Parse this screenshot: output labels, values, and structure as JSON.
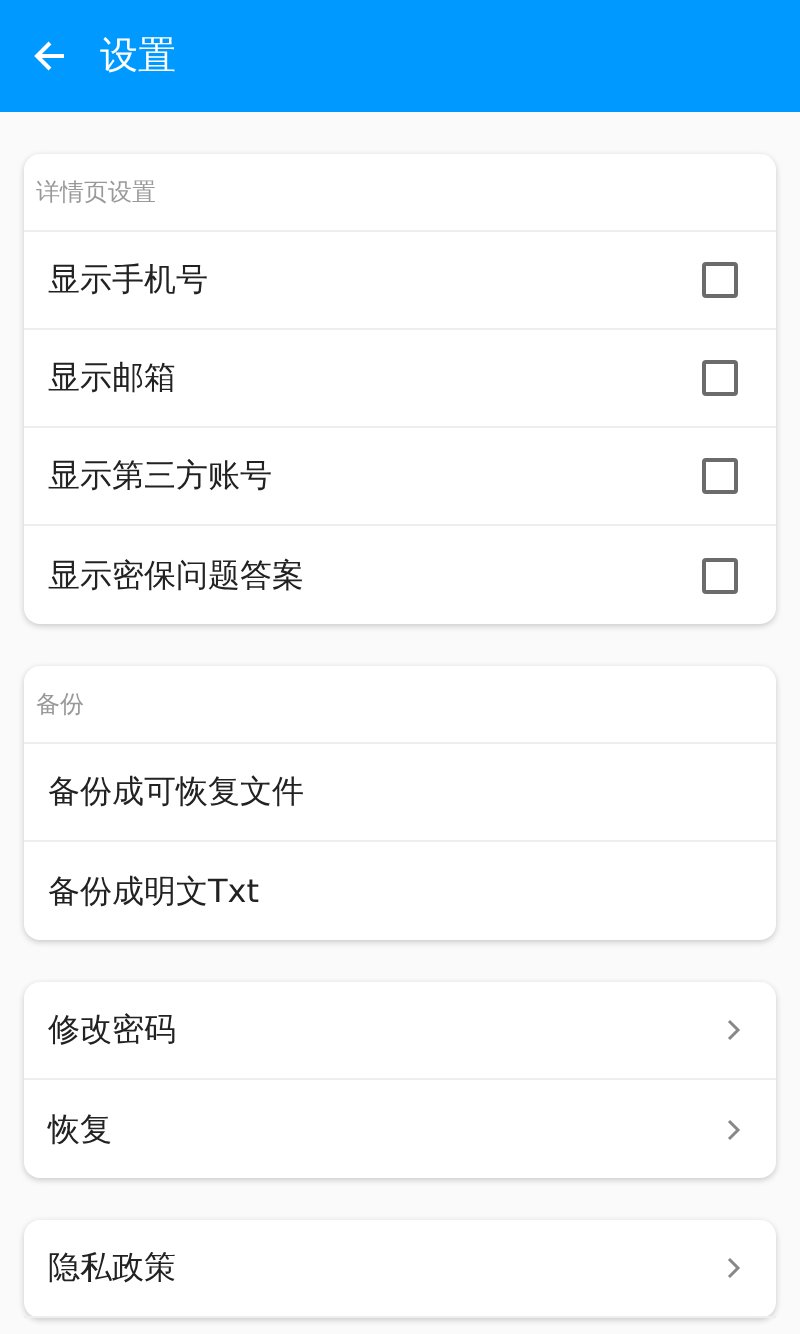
{
  "app_bar": {
    "title": "设置"
  },
  "sections": [
    {
      "header": "详情页设置",
      "items": [
        {
          "kind": "checkbox",
          "label": "显示手机号",
          "checked": false
        },
        {
          "kind": "checkbox",
          "label": "显示邮箱",
          "checked": false
        },
        {
          "kind": "checkbox",
          "label": "显示第三方账号",
          "checked": false
        },
        {
          "kind": "checkbox",
          "label": "显示密保问题答案",
          "checked": false
        }
      ]
    },
    {
      "header": "备份",
      "items": [
        {
          "kind": "plain",
          "label": "备份成可恢复文件"
        },
        {
          "kind": "plain",
          "label": "备份成明文Txt"
        }
      ]
    },
    {
      "items": [
        {
          "kind": "link",
          "label": "修改密码"
        },
        {
          "kind": "link",
          "label": "恢复"
        }
      ]
    },
    {
      "items": [
        {
          "kind": "link",
          "label": "隐私政策"
        }
      ]
    }
  ]
}
